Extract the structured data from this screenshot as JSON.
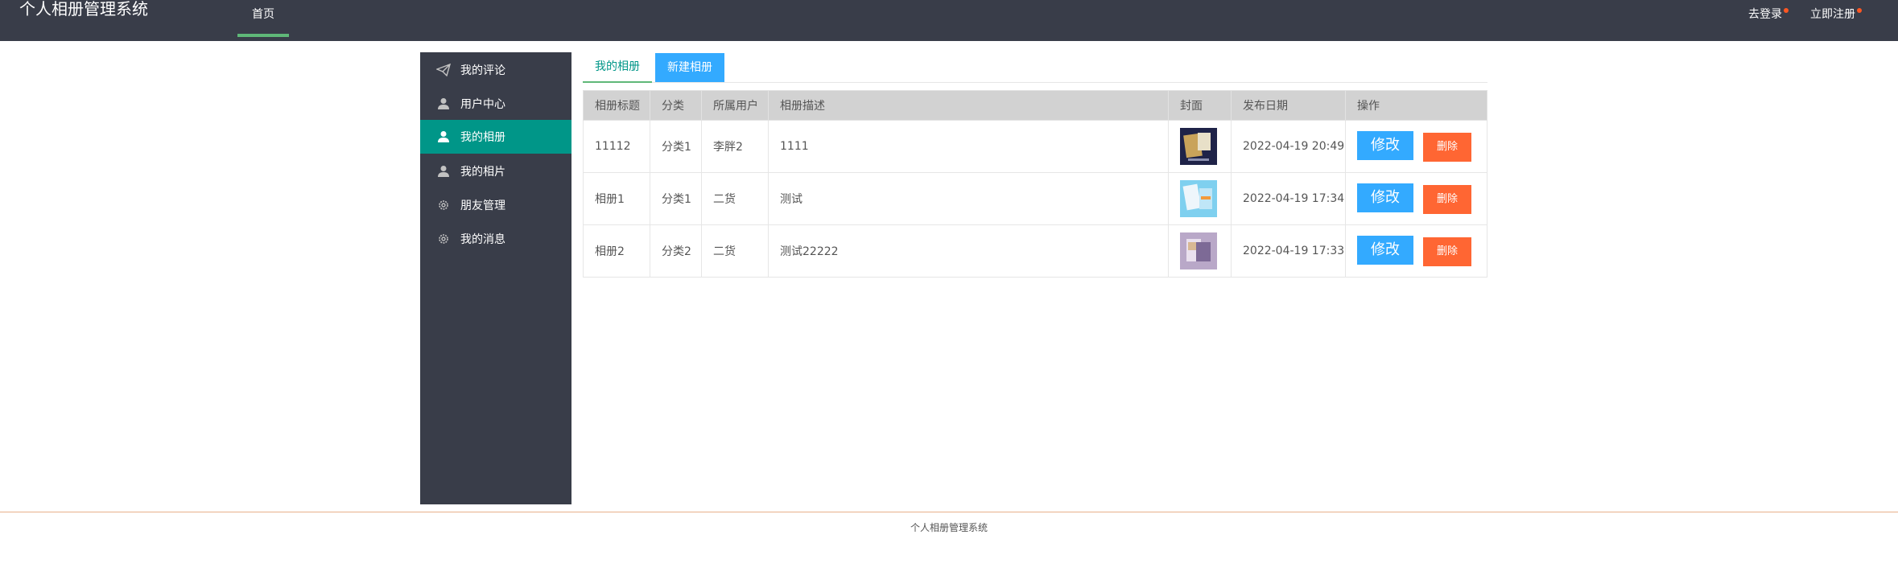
{
  "header": {
    "brand": "个人相册管理系统",
    "nav_home": "首页",
    "login": "去登录",
    "register": "立即注册"
  },
  "sidebar": {
    "items": [
      {
        "label": "我的评论",
        "icon": "paper-plane-icon"
      },
      {
        "label": "用户中心",
        "icon": "user-icon"
      },
      {
        "label": "我的相册",
        "icon": "user-icon"
      },
      {
        "label": "我的相片",
        "icon": "user-icon"
      },
      {
        "label": "朋友管理",
        "icon": "gear-icon"
      },
      {
        "label": "我的消息",
        "icon": "gear-icon"
      }
    ],
    "active_index": 2
  },
  "tabs": {
    "albums": "我的相册",
    "new_album": "新建相册"
  },
  "table": {
    "headers": [
      "相册标题",
      "分类",
      "所属用户",
      "相册描述",
      "封面",
      "发布日期",
      "操作"
    ],
    "rows": [
      {
        "title": "11112",
        "category": "分类1",
        "user": "李胖2",
        "description": "1111",
        "date": "2022-04-19 20:49"
      },
      {
        "title": "相册1",
        "category": "分类1",
        "user": "二货",
        "description": "测试",
        "date": "2022-04-19 17:34"
      },
      {
        "title": "相册2",
        "category": "分类2",
        "user": "二货",
        "description": "测试22222",
        "date": "2022-04-19 17:33"
      }
    ],
    "edit_label": "修改",
    "delete_label": "删除"
  },
  "footer": {
    "text": "个人相册管理系统"
  },
  "colors": {
    "header_bg": "#393d49",
    "active": "#009688",
    "edit": "#33aaff",
    "delete": "#ff6633"
  }
}
